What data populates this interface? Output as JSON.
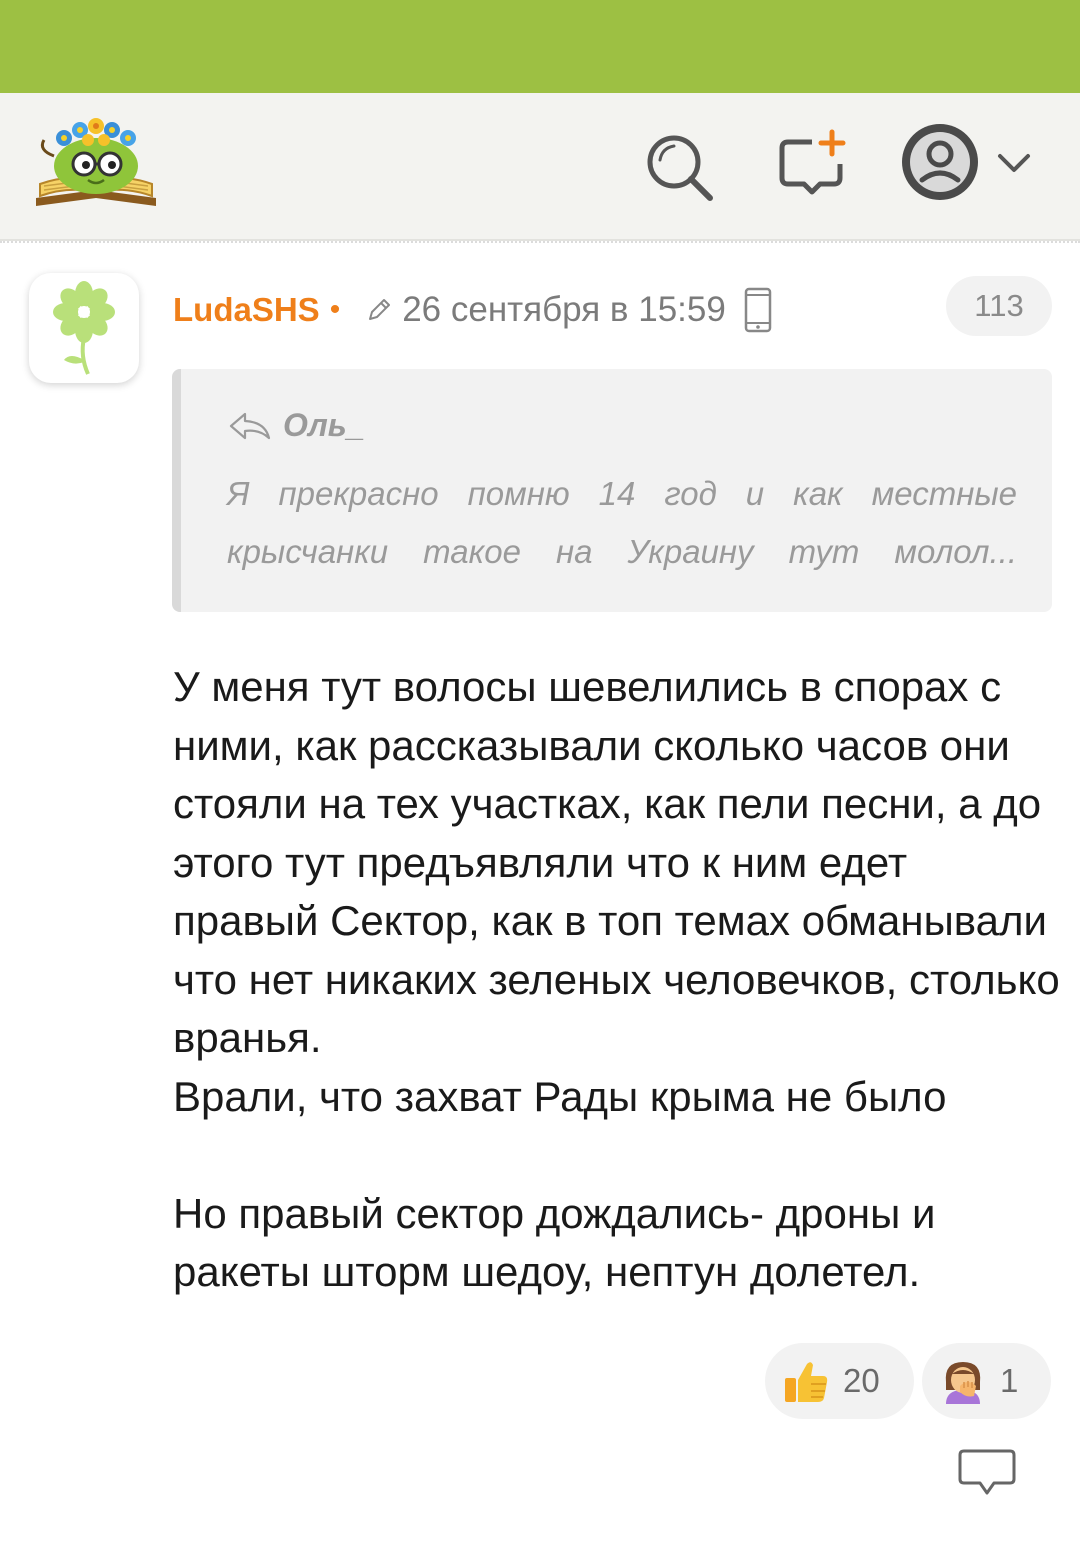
{
  "colors": {
    "status_bar": "#9dc043",
    "header_bg": "#f3f3f0",
    "author": "#ef7f1a",
    "muted": "#9a9a9a"
  },
  "header": {
    "logo_icon": "smiling-book-mascot-icon",
    "search_icon": "search-icon",
    "new_post_icon": "new-post-icon",
    "user_icon": "user-avatar-icon",
    "menu_icon": "chevron-down-icon"
  },
  "post": {
    "avatar_icon": "clover-flower-icon",
    "author": "LudaSHS",
    "separator": "•",
    "timestamp": "26 сентября в 15:59",
    "edited_icon": "pencil-icon",
    "device_icon": "phone-icon",
    "counter": "113",
    "quote": {
      "author": "Оль_",
      "text": "Я прекрасно помню 14 год и как местные крысчанки такое на Украину тут молол..."
    },
    "body": {
      "paragraph1": "У меня тут волосы шевелились в спорах с ними, как рассказывали сколько часов они стояли на тех участках, как пели песни, а до этого тут предъявляли что к ним едет правый Сектор, как в топ темах обманывали что нет никаких зеленых человечков, столько вранья.",
      "paragraph2": "Врали, что захват Рады крыма не было",
      "paragraph3": "Но правый сектор дождались- дроны и ракеты шторм шедоу, нептун долетел."
    },
    "reactions": [
      {
        "icon": "thumbs-up-icon",
        "count": "20"
      },
      {
        "icon": "facepalm-icon",
        "count": "1"
      }
    ],
    "reply_icon": "reply-bubble-icon"
  }
}
